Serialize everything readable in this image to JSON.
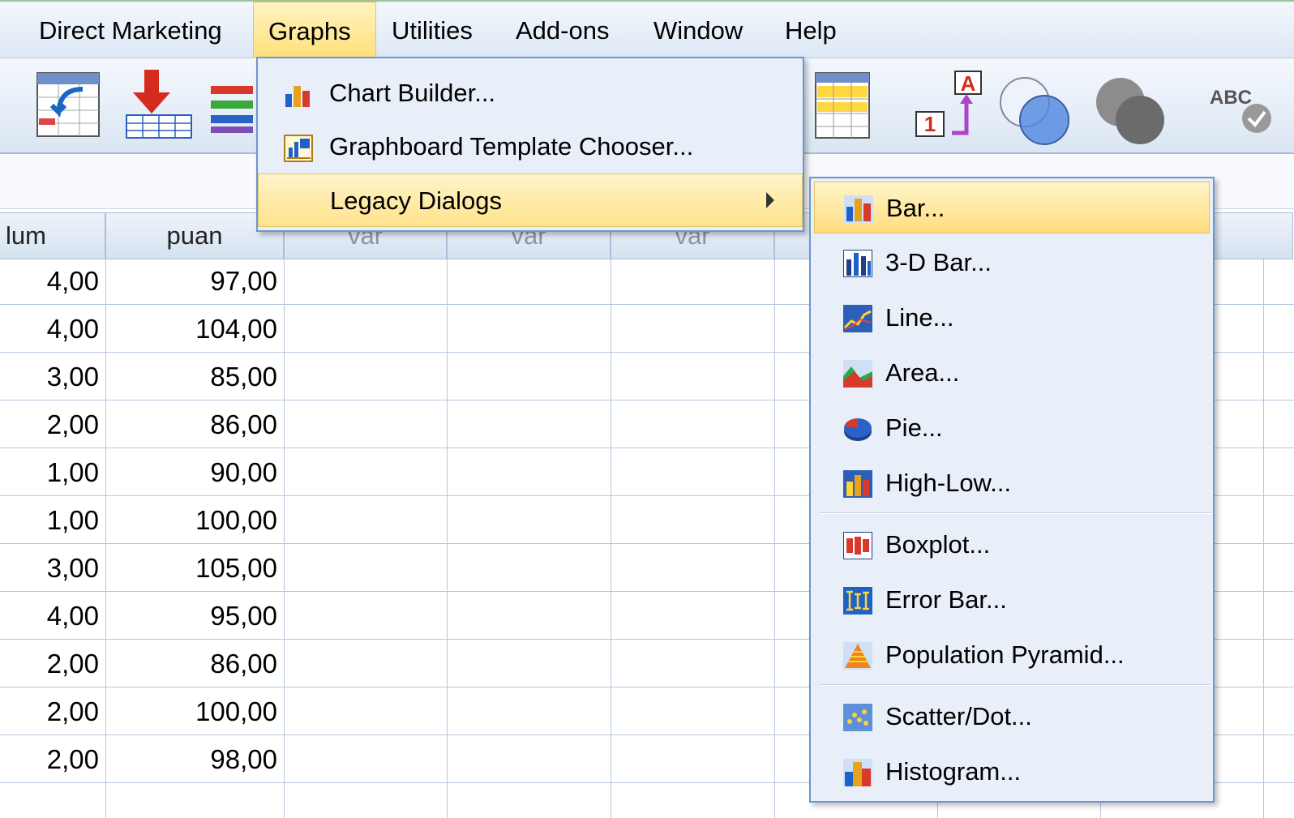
{
  "menubar": {
    "items": [
      {
        "label": "Direct Marketing"
      },
      {
        "label": "Graphs"
      },
      {
        "label": "Utilities"
      },
      {
        "label": "Add-ons"
      },
      {
        "label": "Window"
      },
      {
        "label": "Help"
      }
    ]
  },
  "toolbar": {
    "icons": [
      "recall-dialog-icon",
      "import-data-icon",
      "variables-list-icon",
      "select-cases-icon",
      "value-labels-icon",
      "use-sets-icon",
      "show-all-variables-icon",
      "spell-check-icon"
    ],
    "value_labels_letter": "A",
    "value_labels_number": "1",
    "spell_check_text": "ABC"
  },
  "grid": {
    "columns": [
      "lum",
      "puan",
      "var",
      "var",
      "var"
    ],
    "rows": [
      [
        "4,00",
        "97,00"
      ],
      [
        "4,00",
        "104,00"
      ],
      [
        "3,00",
        "85,00"
      ],
      [
        "2,00",
        "86,00"
      ],
      [
        "1,00",
        "90,00"
      ],
      [
        "1,00",
        "100,00"
      ],
      [
        "3,00",
        "105,00"
      ],
      [
        "4,00",
        "95,00"
      ],
      [
        "2,00",
        "86,00"
      ],
      [
        "2,00",
        "100,00"
      ],
      [
        "2,00",
        "98,00"
      ]
    ]
  },
  "graphs_menu": {
    "items": [
      {
        "label": "Chart Builder...",
        "icon": "chart-builder-icon"
      },
      {
        "label": "Graphboard Template Chooser...",
        "icon": "graphboard-icon"
      },
      {
        "label": "Legacy Dialogs",
        "has_submenu": true
      }
    ]
  },
  "legacy_dialogs": {
    "items": [
      {
        "label": "Bar...",
        "icon": "bar-chart-icon"
      },
      {
        "label": "3-D Bar...",
        "icon": "3d-bar-icon"
      },
      {
        "label": "Line...",
        "icon": "line-chart-icon"
      },
      {
        "label": "Area...",
        "icon": "area-chart-icon"
      },
      {
        "label": "Pie...",
        "icon": "pie-chart-icon"
      },
      {
        "label": "High-Low...",
        "icon": "high-low-icon"
      },
      {
        "label": "Boxplot...",
        "icon": "boxplot-icon"
      },
      {
        "label": "Error Bar...",
        "icon": "error-bar-icon"
      },
      {
        "label": "Population Pyramid...",
        "icon": "population-pyramid-icon"
      },
      {
        "label": "Scatter/Dot...",
        "icon": "scatter-dot-icon"
      },
      {
        "label": "Histogram...",
        "icon": "histogram-icon"
      }
    ]
  },
  "colors": {
    "highlight": "#ffe28c",
    "menu_border": "#6c96cc",
    "menu_bg": "#e8eff8"
  }
}
